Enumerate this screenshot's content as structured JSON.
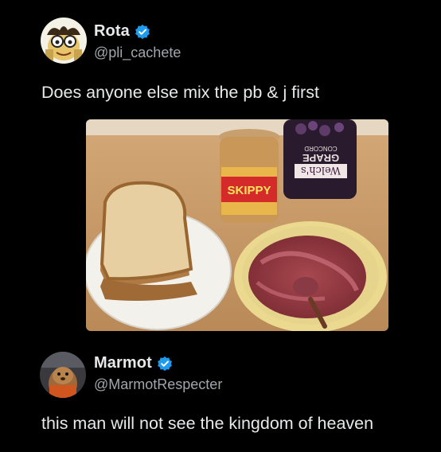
{
  "posts": [
    {
      "author": {
        "display_name": "Rota",
        "handle": "@pli_cachete",
        "verified": true,
        "avatar_icon": "cartoon-avatar-icon"
      },
      "text": "Does anyone else mix the pb & j first",
      "media": {
        "type": "photo",
        "jar_label": "SKIPPY",
        "bottle_label_1": "Welch's",
        "bottle_label_2": "GRAPE",
        "bottle_label_3": "CONCORD"
      }
    },
    {
      "author": {
        "display_name": "Marmot",
        "handle": "@MarmotRespecter",
        "verified": true,
        "avatar_icon": "marmot-avatar-icon"
      },
      "text": "this man will not see the kingdom of heaven"
    }
  ],
  "colors": {
    "background": "#000000",
    "text_primary": "#e7e9ea",
    "text_secondary": "#a1a6ab",
    "verified_badge": "#1d9bf0"
  }
}
